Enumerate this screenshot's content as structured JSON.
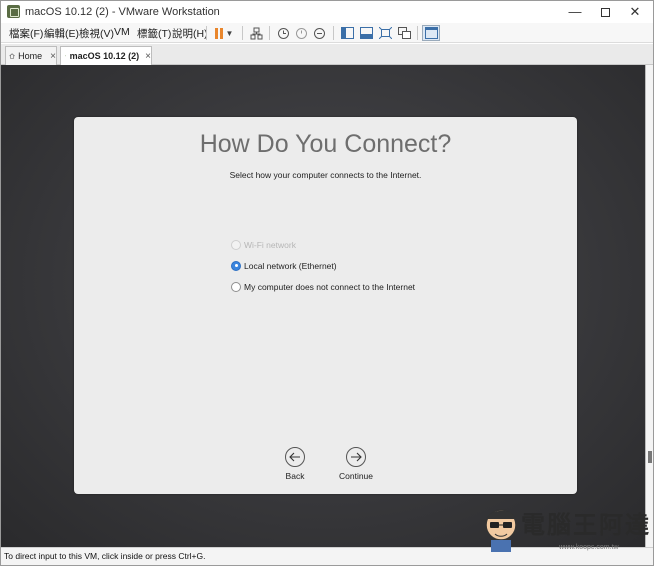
{
  "window": {
    "title": "macOS 10.12 (2) - VMware Workstation",
    "controls": {
      "minimize": "—",
      "close": "✕"
    }
  },
  "menu": {
    "items": [
      "檔案(F)",
      "編輯(E)",
      "檢視(V)",
      "VM",
      "標籤(T)",
      "說明(H)"
    ]
  },
  "tabs": [
    {
      "label": "Home",
      "icon": "home-icon",
      "close": "×"
    },
    {
      "label": "macOS 10.12 (2)",
      "icon": "vm-tab-icon",
      "close": "×",
      "active": true
    }
  ],
  "installer": {
    "title": "How Do You Connect?",
    "subtitle": "Select how your computer connects to the Internet.",
    "options": [
      {
        "label": "Wi-Fi network",
        "selected": false,
        "disabled": true
      },
      {
        "label": "Local network (Ethernet)",
        "selected": true,
        "disabled": false
      },
      {
        "label": "My computer does not connect to the Internet",
        "selected": false,
        "disabled": false
      }
    ],
    "back_label": "Back",
    "continue_label": "Continue"
  },
  "status": {
    "text": "To direct input to this VM, click inside or press Ctrl+G."
  },
  "watermark": {
    "text": "電腦王阿達",
    "url": "www.koopc.com.tw"
  },
  "colors": {
    "accent": "#3a85de",
    "pause": "#e9862c",
    "background": "#38383b"
  }
}
